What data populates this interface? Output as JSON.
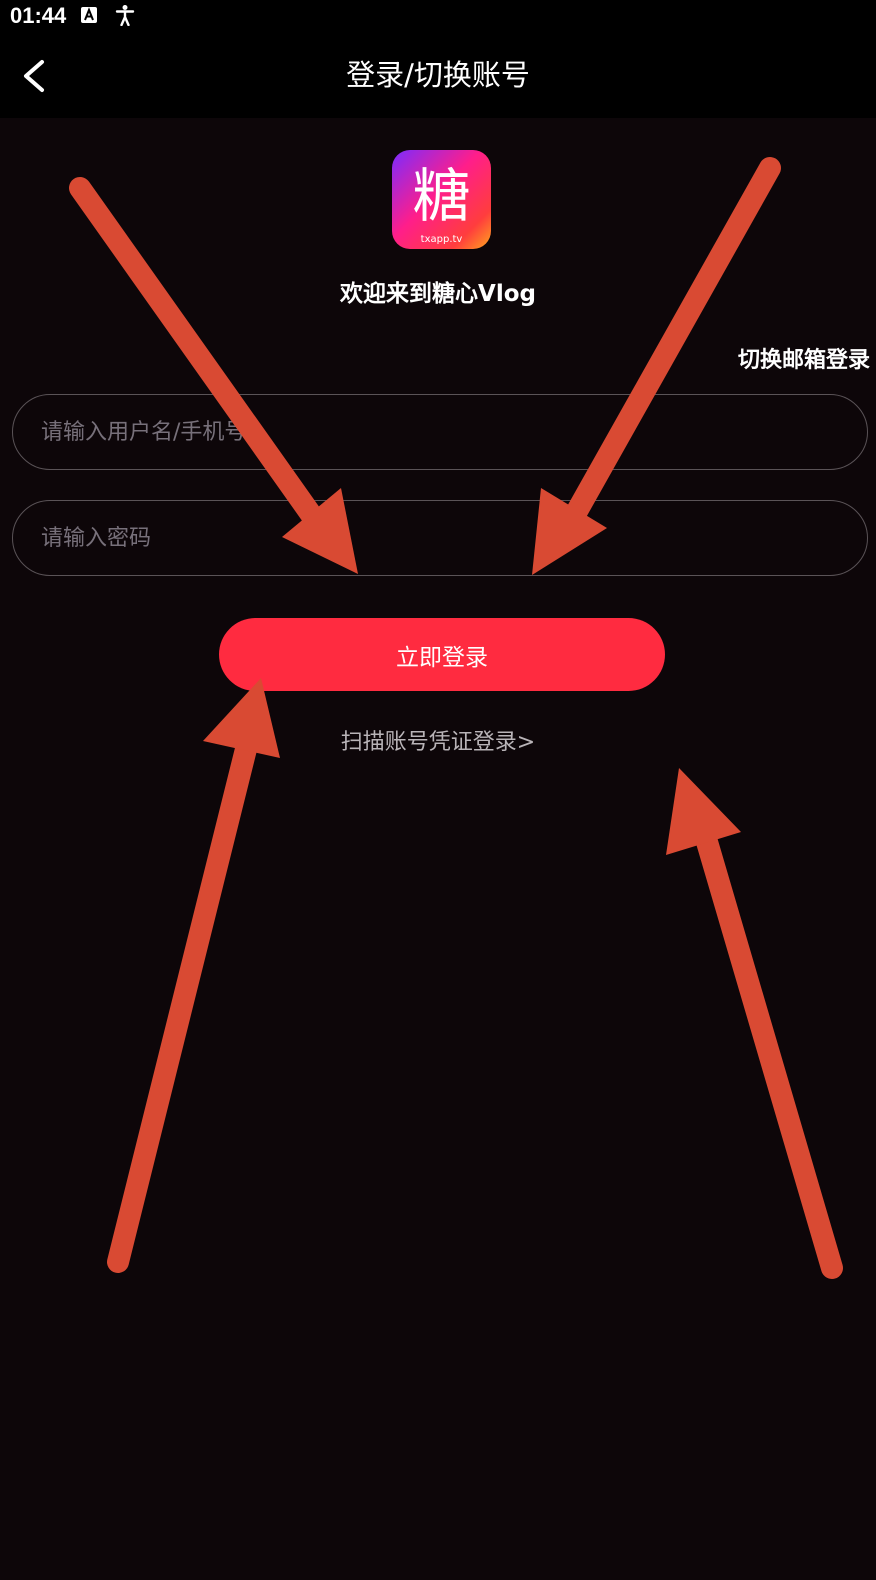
{
  "status_bar": {
    "time": "01:44",
    "icons": [
      "text-a-icon",
      "accessibility-icon"
    ]
  },
  "nav": {
    "title": "登录/切换账号",
    "back_icon": "chevron-left-icon"
  },
  "logo": {
    "glyph": "糖",
    "caption": "txapp.tv"
  },
  "welcome_text": "欢迎来到糖心Vlog",
  "switch_email_label": "切换邮箱登录",
  "username_field": {
    "placeholder": "请输入用户名/手机号",
    "value": ""
  },
  "password_field": {
    "placeholder": "请输入密码",
    "value": ""
  },
  "login_button_label": "立即登录",
  "scan_link_label": "扫描账号凭证登录>",
  "annotation_color": "#d94a33",
  "colors": {
    "background": "#0d0609",
    "primary_button": "#ff2b40"
  }
}
